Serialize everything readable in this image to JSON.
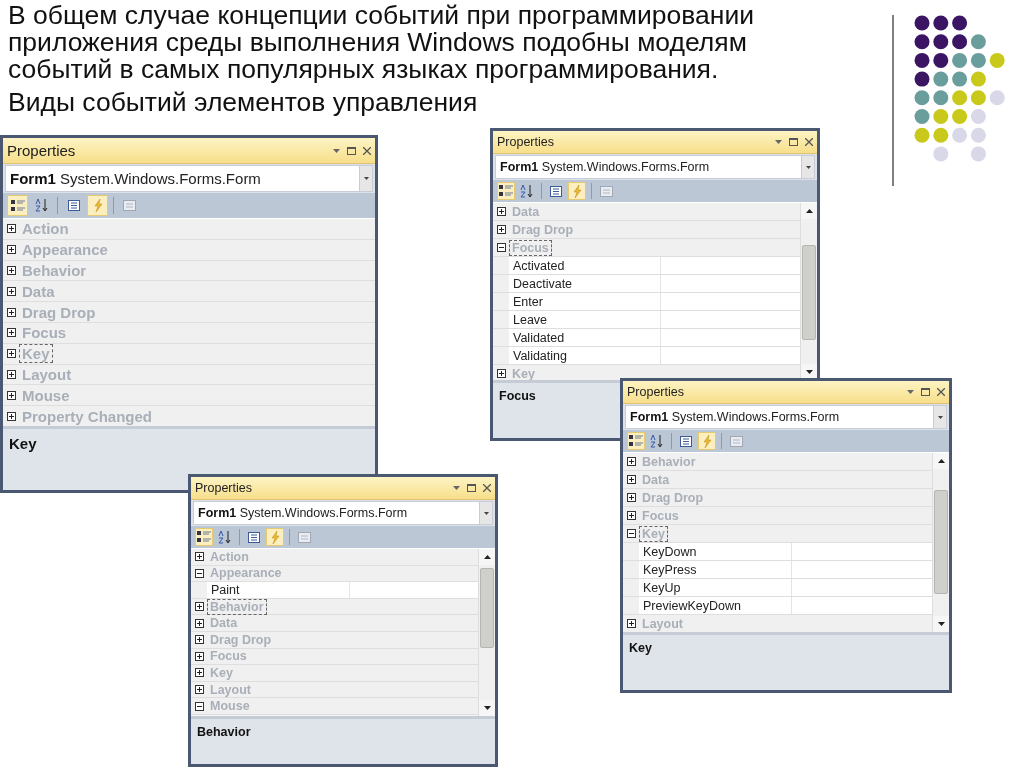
{
  "slide": {
    "text": "В общем случае концепции событий при программировании приложения среды выполнения Windows подобны моделям событий в самых популярных языках программирования.",
    "subtitle": "Виды событий элементов управления"
  },
  "windows": [
    {
      "title": "Properties",
      "object_name": "Form1",
      "object_type": "System.Windows.Forms.Form",
      "scrollable": false,
      "toolbar": [
        {
          "kind": "categorized",
          "selected": true
        },
        {
          "kind": "alphabetical",
          "selected": false
        },
        {
          "kind": "properties",
          "selected": false
        },
        {
          "kind": "events",
          "selected": true
        },
        {
          "kind": "pages",
          "selected": false
        }
      ],
      "rows": [
        {
          "kind": "category",
          "label": "Action",
          "expanded": false,
          "focused": false
        },
        {
          "kind": "category",
          "label": "Appearance",
          "expanded": false,
          "focused": false
        },
        {
          "kind": "category",
          "label": "Behavior",
          "expanded": false,
          "focused": false
        },
        {
          "kind": "category",
          "label": "Data",
          "expanded": false,
          "focused": false
        },
        {
          "kind": "category",
          "label": "Drag Drop",
          "expanded": false,
          "focused": false
        },
        {
          "kind": "category",
          "label": "Focus",
          "expanded": false,
          "focused": false
        },
        {
          "kind": "category",
          "label": "Key",
          "expanded": false,
          "focused": true
        },
        {
          "kind": "category",
          "label": "Layout",
          "expanded": false,
          "focused": false
        },
        {
          "kind": "category",
          "label": "Mouse",
          "expanded": false,
          "focused": false
        },
        {
          "kind": "category",
          "label": "Property Changed",
          "expanded": false,
          "focused": false
        }
      ],
      "description": "Key"
    },
    {
      "title": "Properties",
      "object_name": "Form1",
      "object_type": "System.Windows.Forms.Form",
      "scrollable": true,
      "toolbar": [
        {
          "kind": "categorized",
          "selected": true
        },
        {
          "kind": "alphabetical",
          "selected": false
        },
        {
          "kind": "properties",
          "selected": false
        },
        {
          "kind": "events",
          "selected": true
        },
        {
          "kind": "pages",
          "selected": false
        }
      ],
      "rows": [
        {
          "kind": "category",
          "label": "Data",
          "expanded": false,
          "focused": false
        },
        {
          "kind": "category",
          "label": "Drag Drop",
          "expanded": false,
          "focused": false
        },
        {
          "kind": "category",
          "label": "Focus",
          "expanded": true,
          "focused": true
        },
        {
          "kind": "event",
          "label": "Activated"
        },
        {
          "kind": "event",
          "label": "Deactivate"
        },
        {
          "kind": "event",
          "label": "Enter"
        },
        {
          "kind": "event",
          "label": "Leave"
        },
        {
          "kind": "event",
          "label": "Validated"
        },
        {
          "kind": "event",
          "label": "Validating"
        },
        {
          "kind": "category",
          "label": "Key",
          "expanded": false,
          "focused": false
        }
      ],
      "description": "Focus"
    },
    {
      "title": "Properties",
      "object_name": "Form1",
      "object_type": "System.Windows.Forms.Form",
      "scrollable": true,
      "toolbar": [
        {
          "kind": "categorized",
          "selected": true
        },
        {
          "kind": "alphabetical",
          "selected": false
        },
        {
          "kind": "properties",
          "selected": false
        },
        {
          "kind": "events",
          "selected": true
        },
        {
          "kind": "pages",
          "selected": false
        }
      ],
      "rows": [
        {
          "kind": "category",
          "label": "Action",
          "expanded": false,
          "focused": false
        },
        {
          "kind": "category",
          "label": "Appearance",
          "expanded": true,
          "focused": false
        },
        {
          "kind": "event",
          "label": "Paint"
        },
        {
          "kind": "category",
          "label": "Behavior",
          "expanded": false,
          "focused": true
        },
        {
          "kind": "category",
          "label": "Data",
          "expanded": false,
          "focused": false
        },
        {
          "kind": "category",
          "label": "Drag Drop",
          "expanded": false,
          "focused": false
        },
        {
          "kind": "category",
          "label": "Focus",
          "expanded": false,
          "focused": false
        },
        {
          "kind": "category",
          "label": "Key",
          "expanded": false,
          "focused": false
        },
        {
          "kind": "category",
          "label": "Layout",
          "expanded": false,
          "focused": false
        },
        {
          "kind": "category",
          "label": "Mouse",
          "expanded": true,
          "focused": false
        }
      ],
      "description": "Behavior"
    },
    {
      "title": "Properties",
      "object_name": "Form1",
      "object_type": "System.Windows.Forms.Form",
      "scrollable": true,
      "toolbar": [
        {
          "kind": "categorized",
          "selected": true
        },
        {
          "kind": "alphabetical",
          "selected": false
        },
        {
          "kind": "properties",
          "selected": false
        },
        {
          "kind": "events",
          "selected": true
        },
        {
          "kind": "pages",
          "selected": false
        }
      ],
      "rows": [
        {
          "kind": "category",
          "label": "Behavior",
          "expanded": false,
          "focused": false
        },
        {
          "kind": "category",
          "label": "Data",
          "expanded": false,
          "focused": false
        },
        {
          "kind": "category",
          "label": "Drag Drop",
          "expanded": false,
          "focused": false
        },
        {
          "kind": "category",
          "label": "Focus",
          "expanded": false,
          "focused": false
        },
        {
          "kind": "category",
          "label": "Key",
          "expanded": true,
          "focused": true
        },
        {
          "kind": "event",
          "label": "KeyDown"
        },
        {
          "kind": "event",
          "label": "KeyPress"
        },
        {
          "kind": "event",
          "label": "KeyUp"
        },
        {
          "kind": "event",
          "label": "PreviewKeyDown"
        },
        {
          "kind": "category",
          "label": "Layout",
          "expanded": false,
          "focused": false
        }
      ],
      "description": "Key"
    }
  ]
}
